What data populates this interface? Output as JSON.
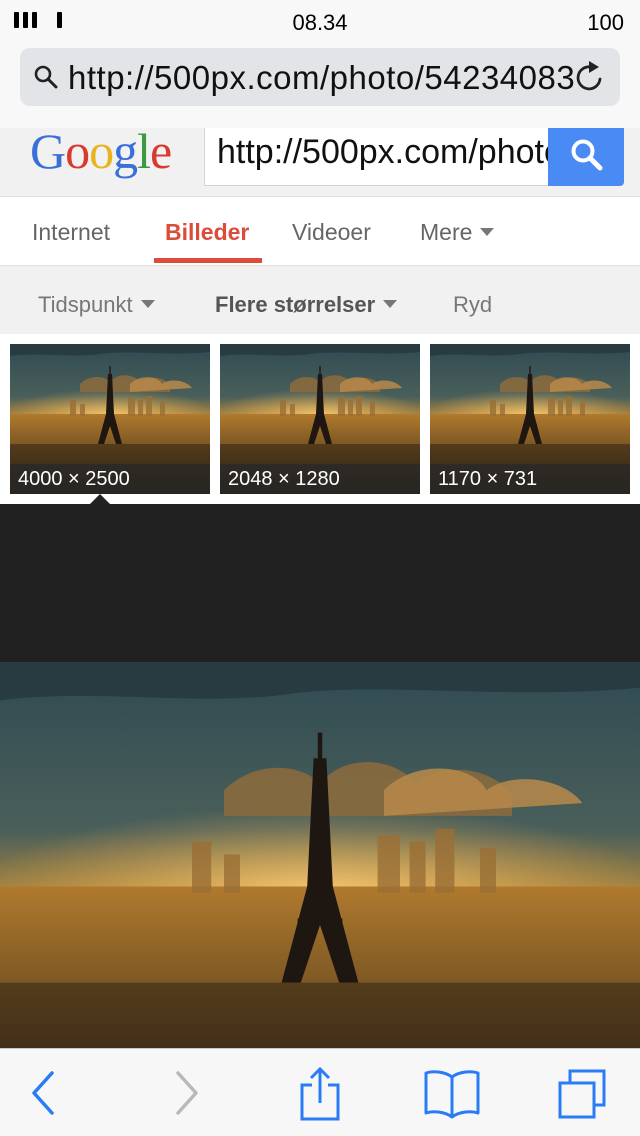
{
  "status_bar": {
    "time": "08.34",
    "battery": "100"
  },
  "url_bar": {
    "url": "http://500px.com/photo/54234083",
    "icon": "search-icon",
    "reload_icon": "reload-icon"
  },
  "google": {
    "logo_letters": [
      {
        "char": "G",
        "color": "#3a6fd8"
      },
      {
        "char": "o",
        "color": "#d83a2f"
      },
      {
        "char": "o",
        "color": "#e9b320"
      },
      {
        "char": "g",
        "color": "#3a6fd8"
      },
      {
        "char": "l",
        "color": "#3a9a3d"
      },
      {
        "char": "e",
        "color": "#d83a2f"
      }
    ],
    "search_value": "http://500px.com/photo/54234083",
    "search_button_icon": "search-icon",
    "accent_color": "#4a8af4"
  },
  "tabs": [
    {
      "label": "Internet",
      "active": false
    },
    {
      "label": "Billeder",
      "active": true
    },
    {
      "label": "Videoer",
      "active": false
    },
    {
      "label": "Mere",
      "active": false,
      "has_caret": true
    }
  ],
  "filters": [
    {
      "label": "Tidspunkt",
      "has_caret": true
    },
    {
      "label": "Flere størrelser",
      "has_caret": true
    },
    {
      "label": "Ryd",
      "has_caret": false
    }
  ],
  "thumbnails": [
    {
      "label": "4000 × 2500",
      "selected": true
    },
    {
      "label": "2048 × 1280",
      "selected": false
    },
    {
      "label": "1170 × 731",
      "selected": false
    }
  ],
  "toolbar": {
    "back_icon": "back-chevron-icon",
    "forward_icon": "forward-chevron-icon",
    "share_icon": "share-icon",
    "bookmarks_icon": "book-icon",
    "tabs_icon": "tabs-icon",
    "accent": "#2a7cf6"
  }
}
